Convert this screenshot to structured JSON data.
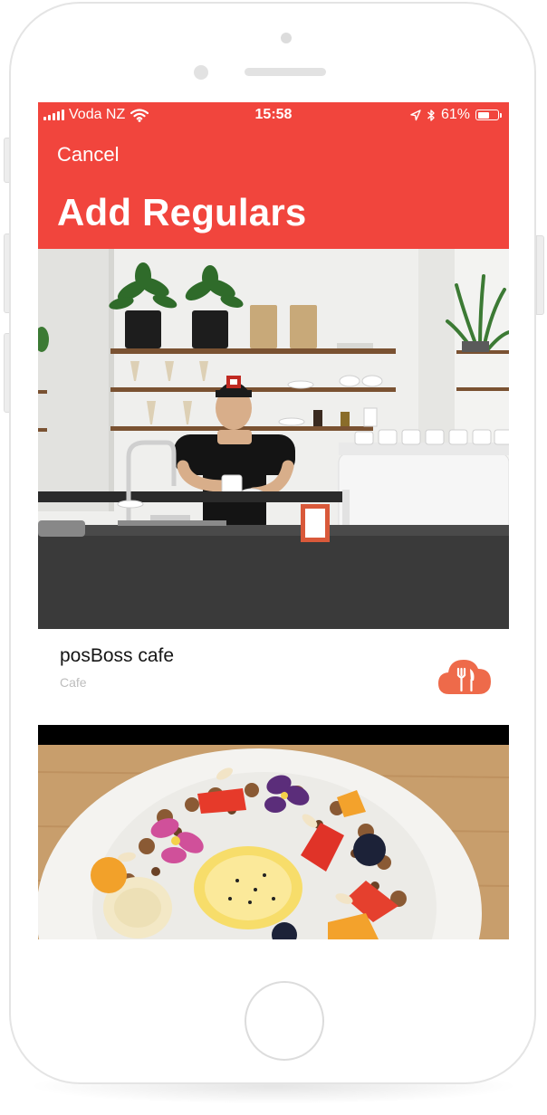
{
  "status_bar": {
    "carrier": "Voda NZ",
    "time": "15:58",
    "battery_percent": "61%",
    "battery_level": 0.61
  },
  "header": {
    "cancel_label": "Cancel",
    "title": "Add Regulars",
    "background_color": "#f1453d"
  },
  "listings": [
    {
      "name": "posBoss cafe",
      "type": "Cafe",
      "icon": "restaurant-cloud-icon",
      "icon_color": "#ee6a4a"
    }
  ]
}
